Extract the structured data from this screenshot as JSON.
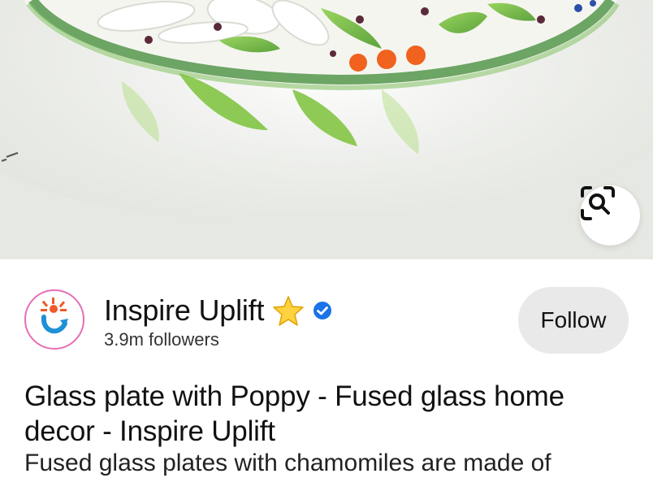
{
  "pin": {
    "image_alt": "Glass plate with Poppy fused glass",
    "lens_icon": "visual-search-icon"
  },
  "creator": {
    "name": "Inspire Uplift",
    "badge_icons": [
      "star-emoji-icon",
      "verified-check-icon"
    ],
    "followers": "3.9m followers",
    "follow_label": "Follow",
    "colors": {
      "follow_bg": "#e9e9e9",
      "verified": "#1a73e8"
    }
  },
  "content": {
    "title": "Glass plate with Poppy - Fused glass home decor - Inspire Uplift",
    "description": "Fused glass plates with chamomiles are made of"
  }
}
